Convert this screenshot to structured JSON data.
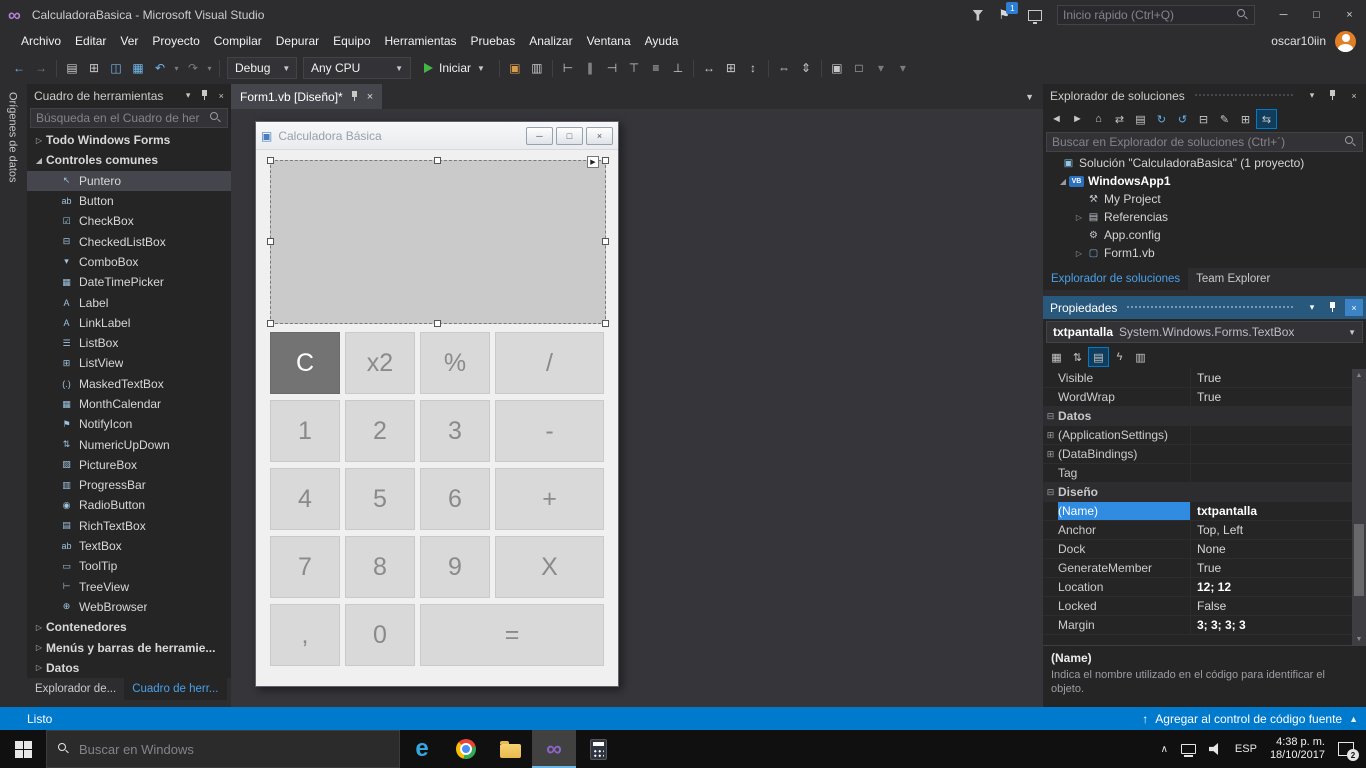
{
  "titlebar": {
    "app_title": "CalculadoraBasica - Microsoft Visual Studio",
    "notification_badge": "1",
    "quick_launch_placeholder": "Inicio rápido (Ctrl+Q)"
  },
  "menubar": {
    "items": [
      "Archivo",
      "Editar",
      "Ver",
      "Proyecto",
      "Compilar",
      "Depurar",
      "Equipo",
      "Herramientas",
      "Pruebas",
      "Analizar",
      "Ventana",
      "Ayuda"
    ],
    "user_name": "oscar10iin"
  },
  "toolbar": {
    "icons_left": [
      {
        "name": "navigate-backward-icon",
        "glyph": "←",
        "cls": "blue"
      },
      {
        "name": "navigate-forward-icon",
        "glyph": "→",
        "cls": "dim"
      },
      {
        "name": "toolbar-separator",
        "glyph": "",
        "cls": "sep",
        "inter": "false"
      },
      {
        "name": "new-project-icon",
        "glyph": "▤",
        "cls": ""
      },
      {
        "name": "add-new-item-icon",
        "glyph": "⊞",
        "cls": ""
      },
      {
        "name": "save-icon",
        "glyph": "◫",
        "cls": "blue"
      },
      {
        "name": "save-all-icon",
        "glyph": "▦",
        "cls": "blue"
      },
      {
        "name": "undo-icon",
        "glyph": "↶",
        "cls": "blue"
      },
      {
        "name": "undo-dropdown-icon",
        "glyph": "▾",
        "cls": "dim caret"
      },
      {
        "name": "redo-icon",
        "glyph": "↷",
        "cls": "dim"
      },
      {
        "name": "redo-dropdown-icon",
        "glyph": "▾",
        "cls": "dim caret"
      },
      {
        "name": "toolbar-separator",
        "glyph": "",
        "cls": "sep",
        "inter": "false"
      }
    ],
    "debug_config": "Debug",
    "platform": "Any CPU",
    "start_label": "Iniciar",
    "icons_right": [
      {
        "name": "toolbar-separator",
        "glyph": "",
        "cls": "sep",
        "inter": "false"
      },
      {
        "name": "add-item-quick-icon",
        "glyph": "▣",
        "cls": "orange"
      },
      {
        "name": "find-in-files-icon",
        "glyph": "▥",
        "cls": ""
      },
      {
        "name": "toolbar-separator",
        "glyph": "",
        "cls": "sep",
        "inter": "false"
      },
      {
        "name": "align-lefts-icon",
        "glyph": "⊢",
        "cls": ""
      },
      {
        "name": "align-centers-icon",
        "glyph": "∥",
        "cls": ""
      },
      {
        "name": "align-rights-icon",
        "glyph": "⊣",
        "cls": ""
      },
      {
        "name": "align-tops-icon",
        "glyph": "⊤",
        "cls": ""
      },
      {
        "name": "align-middles-icon",
        "glyph": "≡",
        "cls": ""
      },
      {
        "name": "align-bottoms-icon",
        "glyph": "⊥",
        "cls": ""
      },
      {
        "name": "toolbar-separator",
        "glyph": "",
        "cls": "sep",
        "inter": "false"
      },
      {
        "name": "make-same-width-icon",
        "glyph": "↔",
        "cls": ""
      },
      {
        "name": "make-same-size-icon",
        "glyph": "⊞",
        "cls": ""
      },
      {
        "name": "make-same-height-icon",
        "glyph": "↕",
        "cls": ""
      },
      {
        "name": "toolbar-separator",
        "glyph": "",
        "cls": "sep",
        "inter": "false"
      },
      {
        "name": "horizontal-spacing-icon",
        "glyph": "⇔",
        "cls": ""
      },
      {
        "name": "vertical-spacing-icon",
        "glyph": "⇕",
        "cls": ""
      },
      {
        "name": "toolbar-separator",
        "glyph": "",
        "cls": "sep",
        "inter": "false"
      },
      {
        "name": "bring-to-front-icon",
        "glyph": "▣",
        "cls": ""
      },
      {
        "name": "send-to-back-icon",
        "glyph": "□",
        "cls": ""
      },
      {
        "name": "toolbar-options-icon",
        "glyph": "▾",
        "cls": "dim"
      },
      {
        "name": "toolbar-options-icon",
        "glyph": "▾",
        "cls": "dim"
      }
    ]
  },
  "activity_bar": {
    "label": "Orígenes de datos"
  },
  "toolbox": {
    "title": "Cuadro de herramientas",
    "search_placeholder": "Búsqueda en el Cuadro de her",
    "entries": [
      {
        "label": "Todo Windows Forms",
        "expander": "▷",
        "icon": "",
        "cls": "group"
      },
      {
        "label": "Controles comunes",
        "expander": "◢",
        "icon": "",
        "cls": "group"
      },
      {
        "label": "Puntero",
        "expander": "",
        "icon": "↖",
        "cls": "item selected"
      },
      {
        "label": "Button",
        "expander": "",
        "icon": "ab",
        "cls": "item"
      },
      {
        "label": "CheckBox",
        "expander": "",
        "icon": "☑",
        "cls": "item"
      },
      {
        "label": "CheckedListBox",
        "expander": "",
        "icon": "⊟",
        "cls": "item"
      },
      {
        "label": "ComboBox",
        "expander": "",
        "icon": "▾",
        "cls": "item"
      },
      {
        "label": "DateTimePicker",
        "expander": "",
        "icon": "▦",
        "cls": "item"
      },
      {
        "label": "Label",
        "expander": "",
        "icon": "A",
        "cls": "item"
      },
      {
        "label": "LinkLabel",
        "expander": "",
        "icon": "A",
        "cls": "item"
      },
      {
        "label": "ListBox",
        "expander": "",
        "icon": "☰",
        "cls": "item"
      },
      {
        "label": "ListView",
        "expander": "",
        "icon": "⊞",
        "cls": "item"
      },
      {
        "label": "MaskedTextBox",
        "expander": "",
        "icon": "(.)",
        "cls": "item"
      },
      {
        "label": "MonthCalendar",
        "expander": "",
        "icon": "▦",
        "cls": "item"
      },
      {
        "label": "NotifyIcon",
        "expander": "",
        "icon": "⚑",
        "cls": "item"
      },
      {
        "label": "NumericUpDown",
        "expander": "",
        "icon": "⇅",
        "cls": "item"
      },
      {
        "label": "PictureBox",
        "expander": "",
        "icon": "▨",
        "cls": "item"
      },
      {
        "label": "ProgressBar",
        "expander": "",
        "icon": "▥",
        "cls": "item"
      },
      {
        "label": "RadioButton",
        "expander": "",
        "icon": "◉",
        "cls": "item"
      },
      {
        "label": "RichTextBox",
        "expander": "",
        "icon": "▤",
        "cls": "item"
      },
      {
        "label": "TextBox",
        "expander": "",
        "icon": "ab",
        "cls": "item"
      },
      {
        "label": "ToolTip",
        "expander": "",
        "icon": "▭",
        "cls": "item"
      },
      {
        "label": "TreeView",
        "expander": "",
        "icon": "⊢",
        "cls": "item"
      },
      {
        "label": "WebBrowser",
        "expander": "",
        "icon": "⊕",
        "cls": "item"
      },
      {
        "label": "Contenedores",
        "expander": "▷",
        "icon": "",
        "cls": "group"
      },
      {
        "label": "Menús y barras de herramie...",
        "expander": "▷",
        "icon": "",
        "cls": "group"
      },
      {
        "label": "Datos",
        "expander": "▷",
        "icon": "",
        "cls": "group"
      }
    ],
    "bottom_tabs": [
      {
        "label": "Explorador de...",
        "cls": ""
      },
      {
        "label": "Cuadro de herr...",
        "cls": "active"
      }
    ]
  },
  "editor": {
    "tab_label": "Form1.vb [Diseño]*"
  },
  "designer_form": {
    "window_title": "Calculadora Básica",
    "buttons": [
      {
        "label": "C",
        "cls": "dark"
      },
      {
        "label": "x2",
        "cls": ""
      },
      {
        "label": "%",
        "cls": ""
      },
      {
        "label": "/",
        "cls": ""
      },
      {
        "label": "1",
        "cls": ""
      },
      {
        "label": "2",
        "cls": ""
      },
      {
        "label": "3",
        "cls": ""
      },
      {
        "label": "-",
        "cls": ""
      },
      {
        "label": "4",
        "cls": ""
      },
      {
        "label": "5",
        "cls": ""
      },
      {
        "label": "6",
        "cls": ""
      },
      {
        "label": "+",
        "cls": ""
      },
      {
        "label": "7",
        "cls": ""
      },
      {
        "label": "8",
        "cls": ""
      },
      {
        "label": "9",
        "cls": ""
      },
      {
        "label": "X",
        "cls": ""
      },
      {
        "label": ",",
        "cls": ""
      },
      {
        "label": "0",
        "cls": ""
      },
      {
        "label": "=",
        "cls": "wide"
      }
    ]
  },
  "solution_explorer": {
    "title": "Explorador de soluciones",
    "search_placeholder": "Buscar en Explorador de soluciones (Ctrl+´)",
    "toolbar_icons": [
      {
        "name": "nav-back-icon",
        "glyph": "◄",
        "cls": "dim"
      },
      {
        "name": "nav-forward-icon",
        "glyph": "►",
        "cls": "dim"
      },
      {
        "name": "home-icon",
        "glyph": "⌂",
        "cls": ""
      },
      {
        "name": "switch-views-icon",
        "glyph": "⇄",
        "cls": ""
      },
      {
        "name": "pending-changes-filter-icon",
        "glyph": "▤",
        "cls": ""
      },
      {
        "name": "sync-icon",
        "glyph": "↻",
        "cls": "blue"
      },
      {
        "name": "refresh-icon",
        "glyph": "↺",
        "cls": "blue"
      },
      {
        "name": "collapse-all-icon",
        "glyph": "⊟",
        "cls": ""
      },
      {
        "name": "properties-icon",
        "glyph": "✎",
        "cls": ""
      },
      {
        "name": "show-all-files-icon",
        "glyph": "⊞",
        "cls": ""
      },
      {
        "name": "sync-with-active-document-icon",
        "glyph": "⇆",
        "cls": "sel"
      }
    ],
    "tree": [
      {
        "expander": "",
        "icon": "▣",
        "icon_cls": "c-sol",
        "label": "Solución \"CalculadoraBasica\" (1 proyecto)",
        "cls": "ind0"
      },
      {
        "expander": "◢",
        "icon": "VB",
        "icon_cls": "vbbox",
        "label": "WindowsApp1",
        "cls": "ind1 bold"
      },
      {
        "expander": "",
        "icon": "⚒",
        "icon_cls": "c-gray",
        "label": "My Project",
        "cls": "ind2"
      },
      {
        "expander": "▷",
        "icon": "▤",
        "icon_cls": "c-gray",
        "label": "Referencias",
        "cls": "ind2"
      },
      {
        "expander": "",
        "icon": "⚙",
        "icon_cls": "c-gray",
        "label": "App.config",
        "cls": "ind2"
      },
      {
        "expander": "▷",
        "icon": "▢",
        "icon_cls": "c-blue",
        "label": "Form1.vb",
        "cls": "ind2"
      }
    ],
    "bottom_tabs": [
      {
        "label": "Explorador de soluciones",
        "cls": "active"
      },
      {
        "label": "Team Explorer",
        "cls": ""
      }
    ]
  },
  "properties_panel": {
    "title": "Propiedades",
    "object_name": "txtpantalla",
    "object_type": "System.Windows.Forms.TextBox",
    "toolbar_icons": [
      {
        "name": "categorized-icon",
        "glyph": "▦",
        "cls": ""
      },
      {
        "name": "alphabetical-icon",
        "glyph": "⇅",
        "cls": ""
      },
      {
        "name": "properties-view-icon",
        "glyph": "▤",
        "cls": "sel"
      },
      {
        "name": "events-icon",
        "glyph": "ϟ",
        "cls": ""
      },
      {
        "name": "property-pages-icon",
        "glyph": "▥",
        "cls": ""
      }
    ],
    "rows": [
      {
        "box": "",
        "name": "Visible",
        "value": "True",
        "cls": "",
        "value_cls": ""
      },
      {
        "box": "",
        "name": "WordWrap",
        "value": "True",
        "cls": "",
        "value_cls": ""
      },
      {
        "box": "⊟",
        "name": "Datos",
        "value": "",
        "cls": "cat",
        "value_cls": ""
      },
      {
        "box": "⊞",
        "name": "(ApplicationSettings)",
        "value": "",
        "cls": "",
        "value_cls": ""
      },
      {
        "box": "⊞",
        "name": "(DataBindings)",
        "value": "",
        "cls": "",
        "value_cls": ""
      },
      {
        "box": "",
        "name": "Tag",
        "value": "",
        "cls": "",
        "value_cls": ""
      },
      {
        "box": "⊟",
        "name": "Diseño",
        "value": "",
        "cls": "cat",
        "value_cls": ""
      },
      {
        "box": "",
        "name": "(Name)",
        "value": "txtpantalla",
        "cls": "selected",
        "value_cls": "bold"
      },
      {
        "box": "",
        "name": "Anchor",
        "value": "Top, Left",
        "cls": "",
        "value_cls": ""
      },
      {
        "box": "",
        "name": "Dock",
        "value": "None",
        "cls": "",
        "value_cls": ""
      },
      {
        "box": "",
        "name": "GenerateMember",
        "value": "True",
        "cls": "",
        "value_cls": ""
      },
      {
        "box": "",
        "name": "Location",
        "value": "12; 12",
        "cls": "",
        "value_cls": "bold"
      },
      {
        "box": "",
        "name": "Locked",
        "value": "False",
        "cls": "",
        "value_cls": ""
      },
      {
        "box": "",
        "name": "Margin",
        "value": "3; 3; 3; 3",
        "cls": "",
        "value_cls": "bold"
      }
    ],
    "description_title": "(Name)",
    "description_text": "Indica el nombre utilizado en el código para identificar el objeto."
  },
  "statusbar": {
    "ready": "Listo",
    "source_control": "Agregar al control de código fuente"
  },
  "taskbar": {
    "search_placeholder": "Buscar en Windows",
    "language": "ESP",
    "time": "4:38 p. m.",
    "date": "18/10/2017",
    "notification_count": "2"
  }
}
